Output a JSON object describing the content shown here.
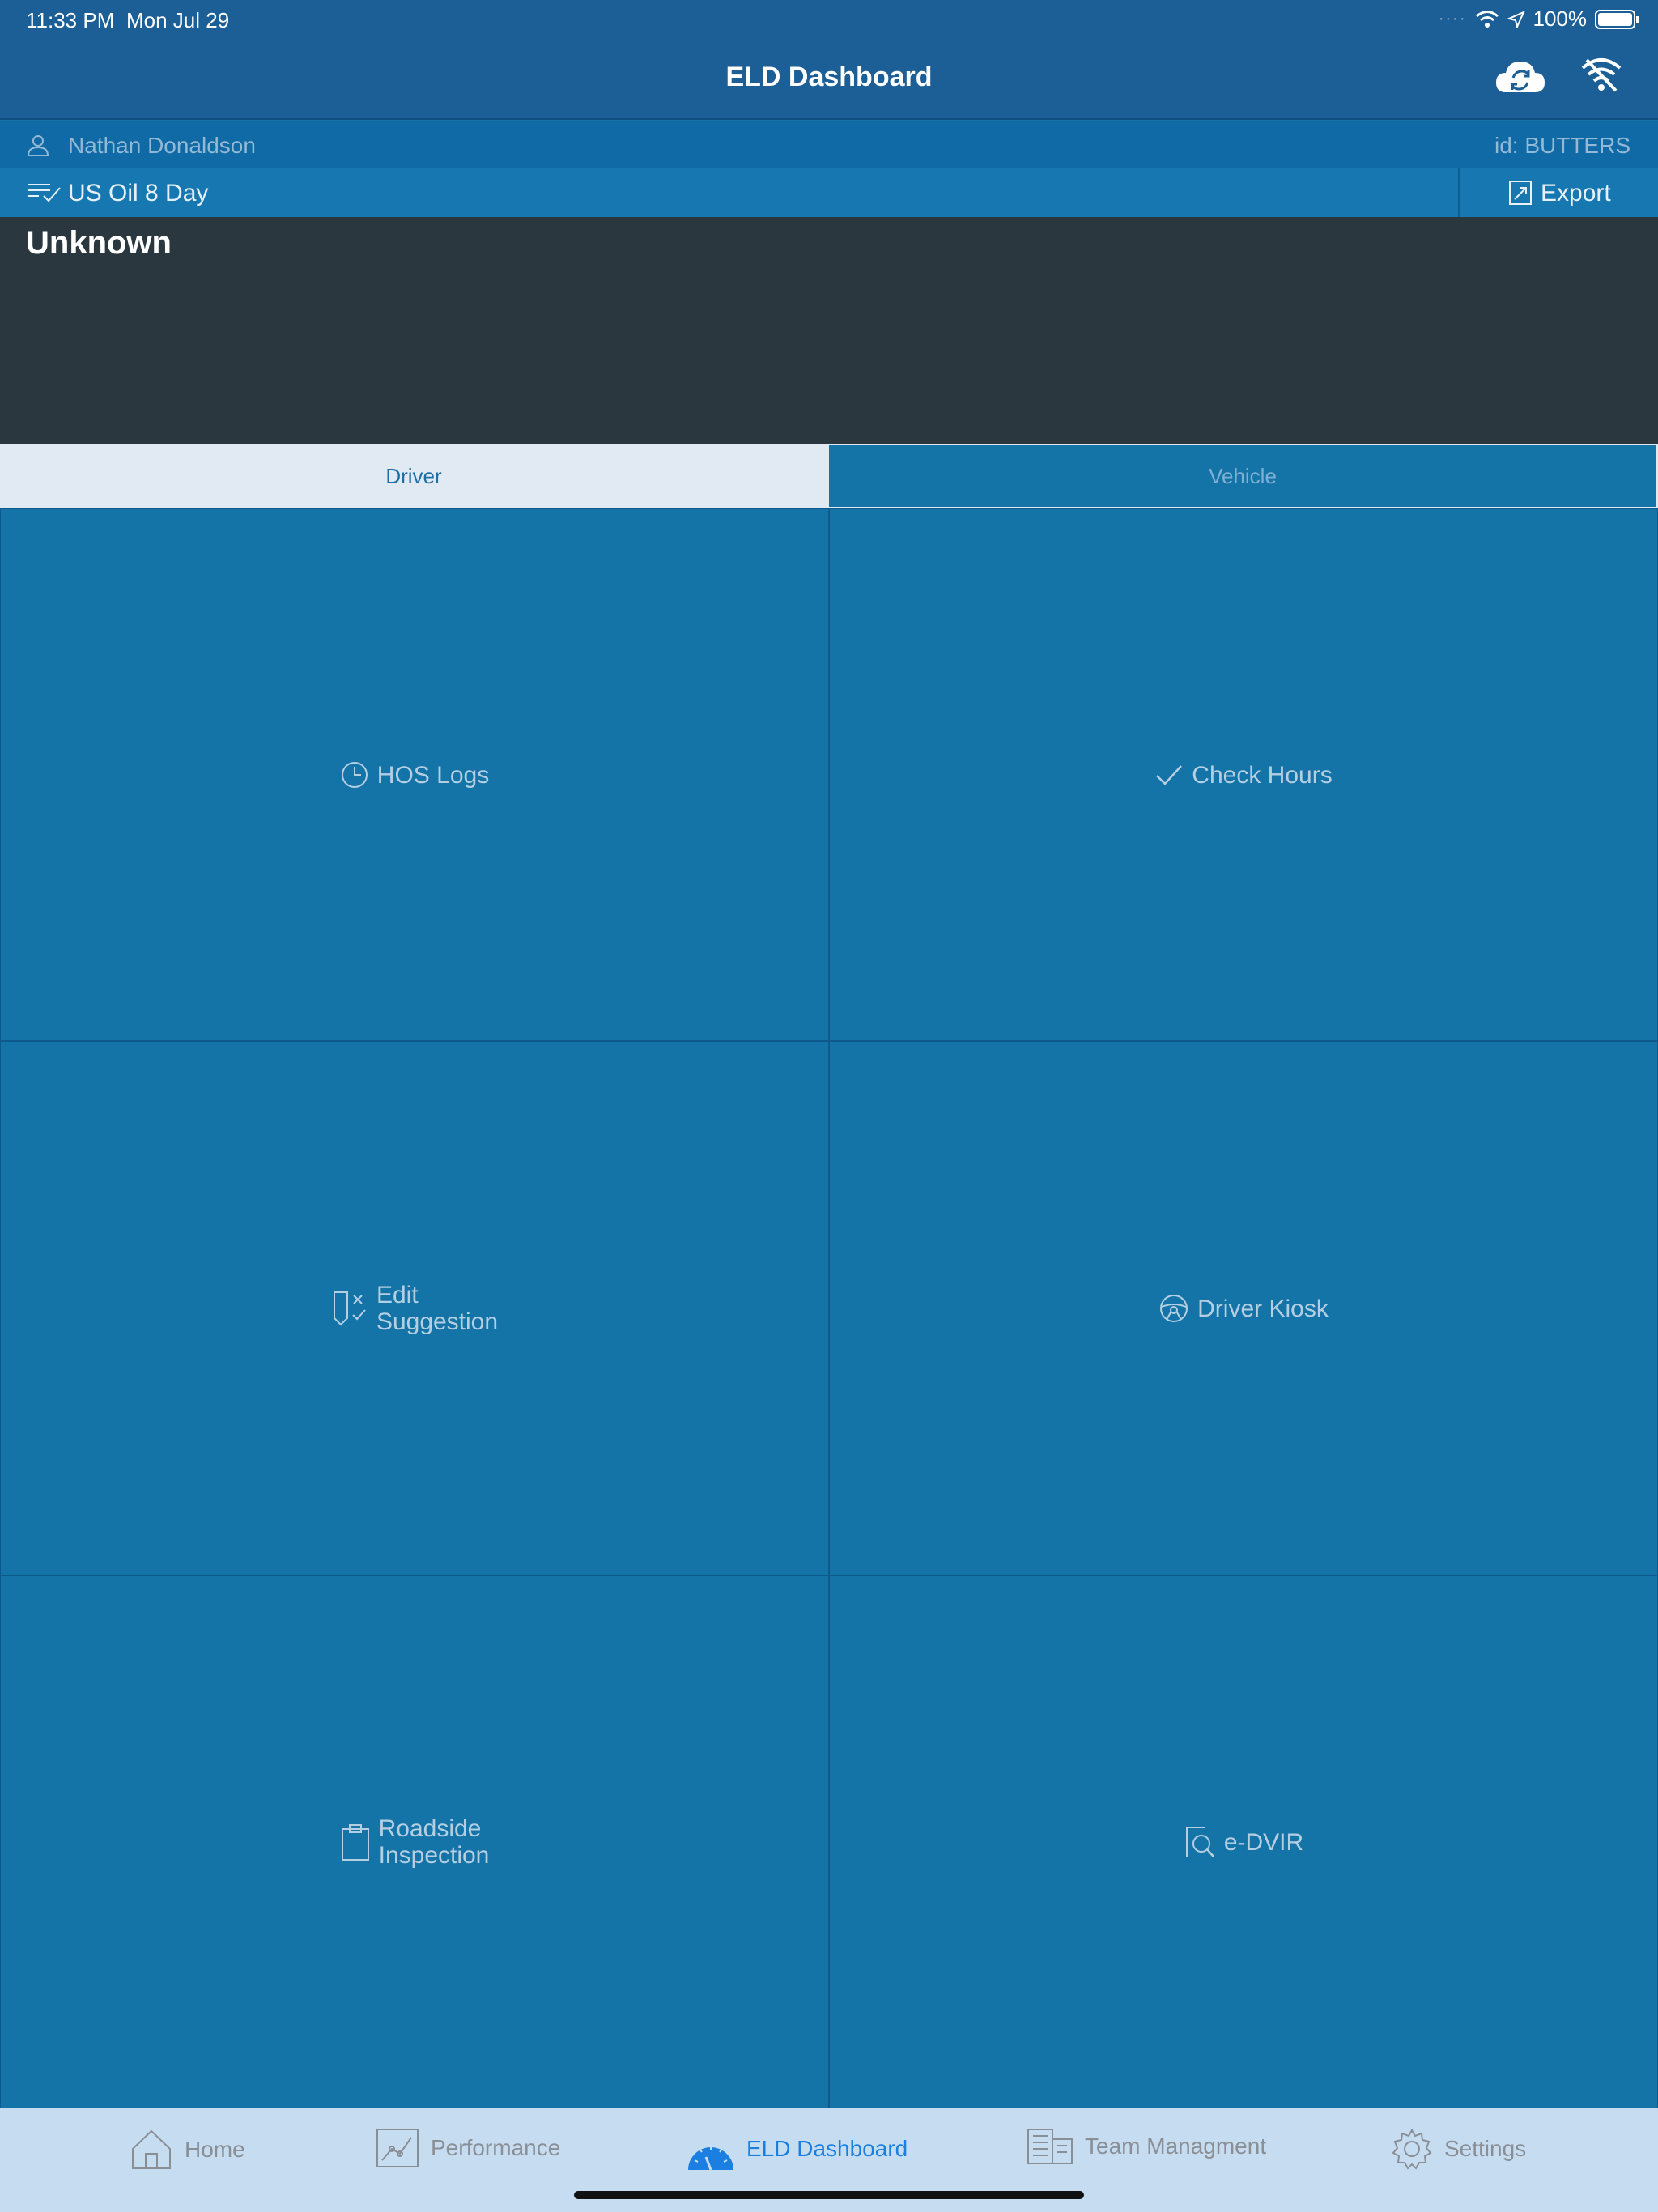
{
  "status_bar": {
    "time": "11:33 PM",
    "date": "Mon Jul 29",
    "battery": "100%"
  },
  "nav": {
    "title": "ELD Dashboard"
  },
  "user": {
    "name": "Nathan Donaldson",
    "id": "id: BUTTERS"
  },
  "ruleset": {
    "name": "US Oil 8 Day",
    "export_label": "Export"
  },
  "driver_status": "Unknown",
  "tabs": [
    {
      "label": "Driver",
      "active": true
    },
    {
      "label": "Vehicle",
      "active": false
    }
  ],
  "tiles": [
    {
      "label": "HOS Logs",
      "icon": "clock-icon"
    },
    {
      "label": "Check Hours",
      "icon": "checkmark-icon"
    },
    {
      "label": "Edit\nSuggestion",
      "icon": "edit-suggestion-icon"
    },
    {
      "label": "Driver Kiosk",
      "icon": "steering-wheel-icon"
    },
    {
      "label": "Roadside\nInspection",
      "icon": "clipboard-icon"
    },
    {
      "label": "e-DVIR",
      "icon": "document-search-icon"
    }
  ],
  "bottom_tabs": [
    {
      "label": "Home",
      "icon": "home-icon"
    },
    {
      "label": "Performance",
      "icon": "performance-chart-icon"
    },
    {
      "label": "ELD Dashboard",
      "icon": "speedometer-icon",
      "active": true
    },
    {
      "label": "Team Managment",
      "icon": "building-icon"
    },
    {
      "label": "Settings",
      "icon": "gear-icon"
    }
  ],
  "colors": {
    "header": "#1b5f96",
    "tile": "#1474a8",
    "status_panel": "#2b373e",
    "tab_bar": "#c6dcf0",
    "active_tab": "#1a7fe0"
  }
}
